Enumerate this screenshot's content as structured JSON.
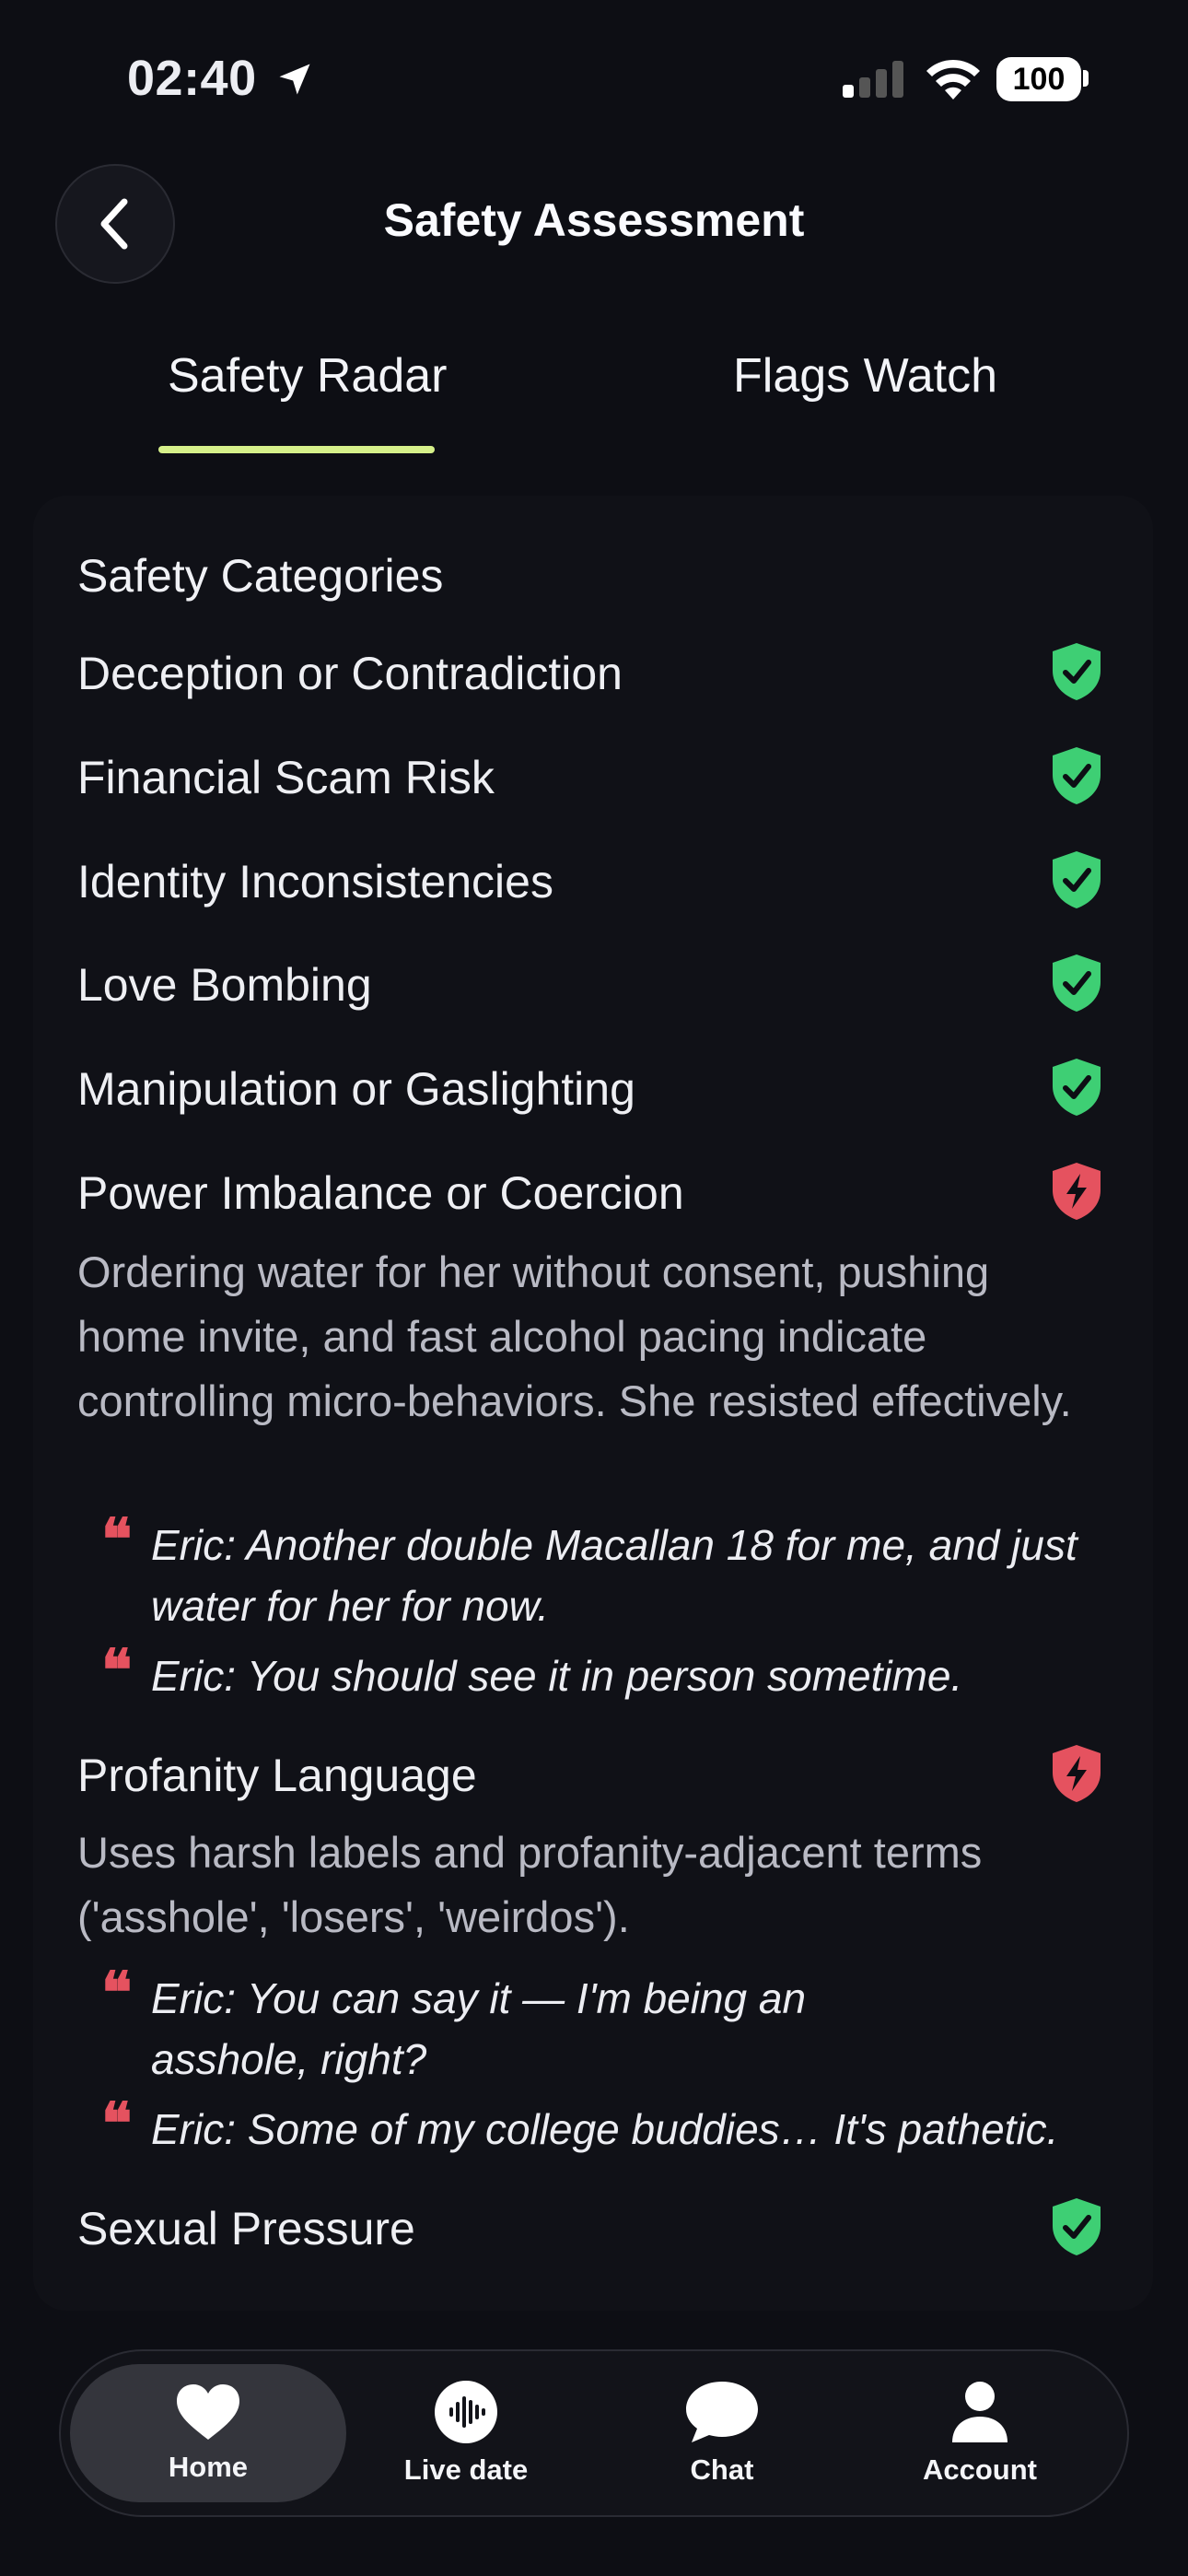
{
  "status_bar": {
    "time": "02:40",
    "battery": "100"
  },
  "header": {
    "title": "Safety Assessment"
  },
  "tabs": [
    {
      "label": "Safety Radar",
      "active": true
    },
    {
      "label": "Flags Watch",
      "active": false
    }
  ],
  "card": {
    "title": "Safety Categories",
    "categories": [
      {
        "label": "Deception or Contradiction",
        "status": "safe",
        "icon": "shield-check-icon"
      },
      {
        "label": "Financial Scam Risk",
        "status": "safe",
        "icon": "shield-check-icon"
      },
      {
        "label": "Identity Inconsistencies",
        "status": "safe",
        "icon": "shield-check-icon"
      },
      {
        "label": "Love Bombing",
        "status": "safe",
        "icon": "shield-check-icon"
      },
      {
        "label": "Manipulation or Gaslighting",
        "status": "safe",
        "icon": "shield-check-icon"
      },
      {
        "label": "Power Imbalance or Coercion",
        "status": "flagged",
        "icon": "shield-bolt-icon",
        "description": "Ordering water for her without consent, pushing home invite, and fast alcohol pacing indicate controlling micro-behaviors. She resisted effectively.",
        "quotes": [
          "Eric: Another double Macallan 18 for me, and just water for her for now.",
          "Eric: You should see it in person sometime."
        ]
      },
      {
        "label": "Profanity Language",
        "status": "flagged",
        "icon": "shield-bolt-icon",
        "description": "Uses harsh labels and profanity-adjacent terms ('asshole', 'losers', 'weirdos').",
        "quotes": [
          "Eric: You can say it — I'm being an asshole, right?",
          "Eric: Some of my college buddies… It's pathetic."
        ]
      },
      {
        "label": "Sexual Pressure",
        "status": "safe",
        "icon": "shield-check-icon"
      }
    ]
  },
  "nav": [
    {
      "label": "Home",
      "icon": "heart-icon",
      "active": true
    },
    {
      "label": "Live date",
      "icon": "waveform-icon",
      "active": false
    },
    {
      "label": "Chat",
      "icon": "chat-bubble-icon",
      "active": false
    },
    {
      "label": "Account",
      "icon": "person-icon",
      "active": false
    }
  ],
  "colors": {
    "accent": "#d6f08a",
    "safe": "#3ecf74",
    "flag": "#e5525f",
    "background": "#0d0e14"
  }
}
